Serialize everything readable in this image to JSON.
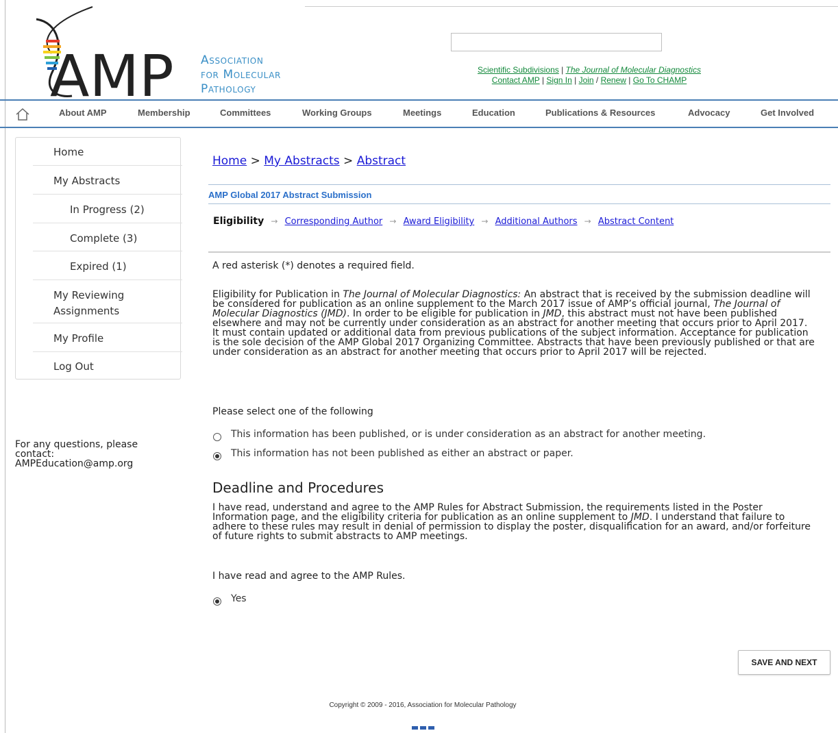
{
  "header": {
    "logo_letters": "AMP",
    "logo_text": [
      "Association",
      "for Molecular",
      "Pathology"
    ],
    "util_links_line1": [
      {
        "label": "Scientific Subdivisions"
      },
      {
        "label": "The Journal of Molecular Diagnostics"
      }
    ],
    "util_links_line2": [
      {
        "label": "Contact AMP"
      },
      {
        "label": "Sign In"
      },
      {
        "label": "Join"
      },
      {
        "label": "Renew"
      },
      {
        "label": "Go To CHAMP"
      }
    ],
    "search_value": ""
  },
  "nav": {
    "items": [
      "About AMP",
      "Membership",
      "Committees",
      "Working Groups",
      "Meetings",
      "Education",
      "Publications & Resources",
      "Advocacy",
      "Get Involved"
    ]
  },
  "sidebar": {
    "items": [
      {
        "label": "Home",
        "level": 1
      },
      {
        "label": "My Abstracts",
        "level": 1
      },
      {
        "label": "In Progress (2)",
        "level": 2
      },
      {
        "label": "Complete (3)",
        "level": 2
      },
      {
        "label": "Expired (1)",
        "level": 2
      },
      {
        "label": "My Reviewing Assignments",
        "level": 1
      },
      {
        "label": "My Profile",
        "level": 1
      },
      {
        "label": "Log Out",
        "level": 1
      }
    ],
    "contact": "For any questions, please contact: AMPEducation@amp.org"
  },
  "breadcrumb": {
    "items": [
      "Home",
      "My Abstracts",
      "Abstract"
    ],
    "separator": ">"
  },
  "submission_title": "AMP Global 2017 Abstract Submission",
  "steps": {
    "current": "Eligibility",
    "links": [
      "Corresponding Author",
      "Award Eligibility",
      "Additional Authors",
      "Abstract Content"
    ]
  },
  "required_note": "A red asterisk (*) denotes a required field.",
  "eligibility": {
    "lead": "Eligibility for Publication in ",
    "journal_name": "The Journal of Molecular Diagnostics:",
    "text_a": " An abstract that is received by the submission deadline will be considered for publication as an online supplement to the March 2017 issue of AMP’s official journal, ",
    "journal_name2": "The Journal of Molecular Diagnostics (JMD)",
    "text_b": ". In order to be eligible for publication in ",
    "jmd": "JMD",
    "text_c": ", this abstract must not have been published elsewhere and may not be currently under consideration as an abstract for another meeting that occurs prior to April 2017. It must contain updated or additional data from previous publications of the subject information. Acceptance for publication is the sole decision of the AMP Global 2017 Organizing Committee. Abstracts that have been previously published or that are under consideration as an abstract for another meeting that occurs prior to April 2017 will be rejected."
  },
  "select_prompt": "Please select one of the following",
  "options": [
    {
      "label": "This information has been published, or is under consideration as an abstract for another meeting.",
      "checked": false
    },
    {
      "label": "This information has not been published as either an abstract or paper.",
      "checked": true
    }
  ],
  "deadline": {
    "heading": "Deadline and Procedures",
    "text_a": "I have read, understand and agree to the AMP Rules for Abstract Submission, the requirements listed in the Poster Information page, and the eligibility criteria for publication as an online supplement to ",
    "jmd": "JMD",
    "text_b": ". I understand that failure to adhere to these rules may result in denial of permission to display the poster, disqualification for an award, and/or forfeiture of future rights to submit abstracts to AMP meetings."
  },
  "agree_prompt": "I have read and agree to the AMP Rules.",
  "agree_option": {
    "label": "Yes",
    "checked": true
  },
  "save_button": "SAVE AND NEXT",
  "copyright": "Copyright © 2009 - 2016, Association for Molecular Pathology",
  "colors": {
    "nav_rule": "#4a7fb5",
    "accent": "#2a6fc9",
    "link": "#1a1ad6",
    "util_link": "#11883a"
  }
}
